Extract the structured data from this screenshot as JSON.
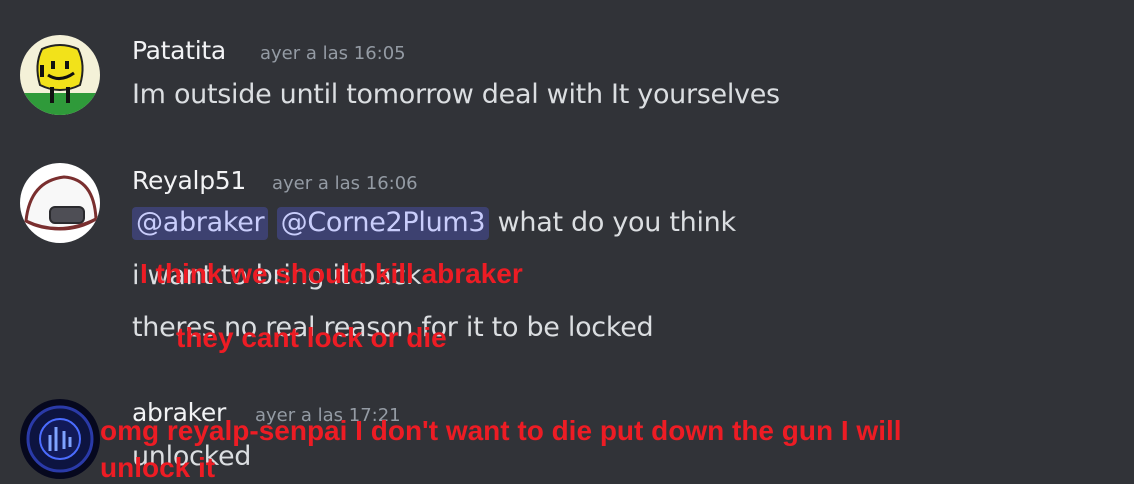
{
  "colors": {
    "background": "#313338",
    "username": "#f2f3f5",
    "timestamp": "#949ba4",
    "message_text": "#dbdee1",
    "mention_bg": "#3c4270",
    "mention_text": "#c9cdfb",
    "overlay_red": "#ed1c24"
  },
  "messages": [
    {
      "author": "Patatita",
      "timestamp": "ayer a las 16:05",
      "avatar_icon": "yellow-smiley-avatar-icon",
      "lines": [
        "Im outside until tomorrow deal with It yourselves"
      ]
    },
    {
      "author": "Reyalp51",
      "timestamp": "ayer a las 16:06",
      "avatar_icon": "white-rice-ball-avatar-icon",
      "mentions": [
        "@abraker",
        "@Corne2Plum3"
      ],
      "first_line_rest": "what do you think",
      "lines": [
        "i want to bring it back",
        "theres no real reason for it to be locked"
      ]
    },
    {
      "author": "abraker",
      "timestamp": "ayer a las 17:21",
      "avatar_icon": "blue-logo-avatar-icon",
      "lines": [
        "unlocked"
      ]
    }
  ],
  "overlays": [
    "I think we should kill abraker",
    "they cant lock or die",
    "omg reyalp-senpai I don't want to die put down the gun I will",
    "unlock it"
  ]
}
